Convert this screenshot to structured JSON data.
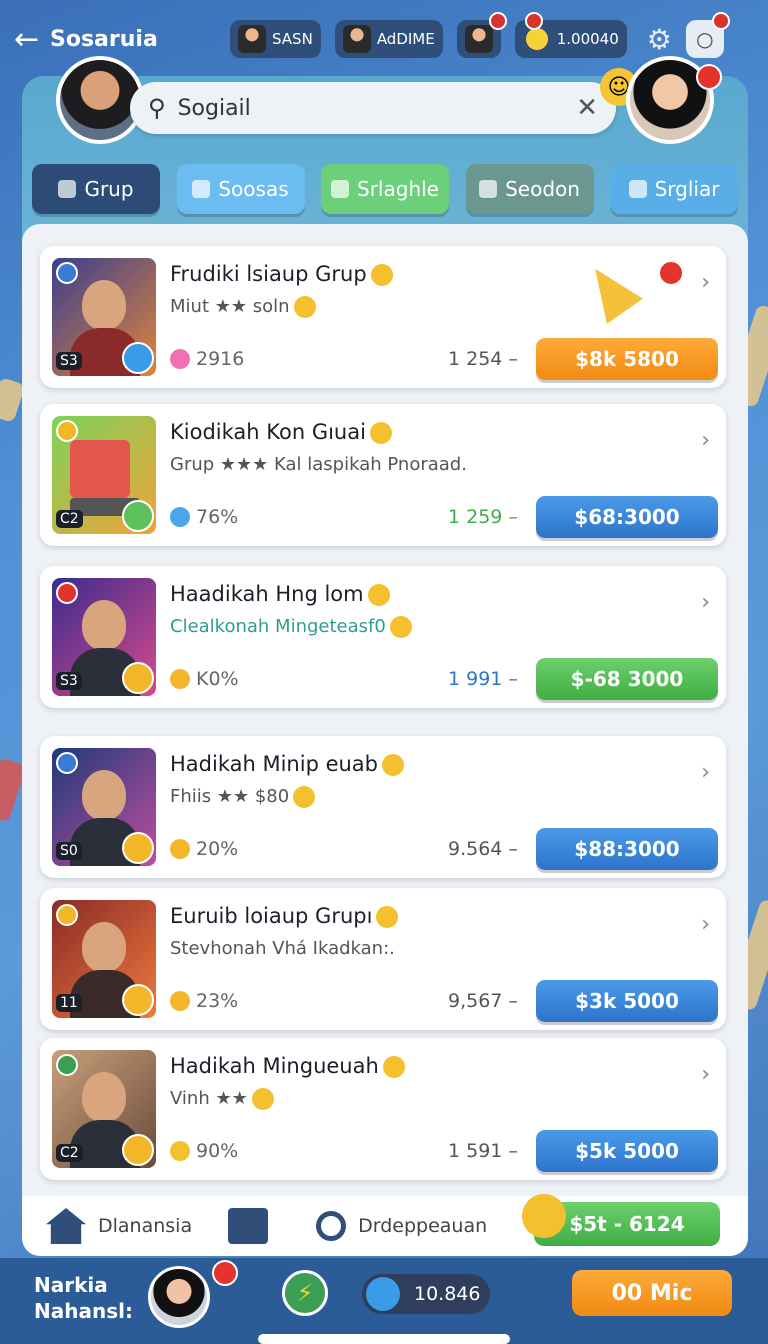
{
  "topbar": {
    "title": "Sosaruia",
    "chips": [
      {
        "label": "SASN"
      },
      {
        "label": "AdDIME"
      },
      {
        "label": ""
      },
      {
        "label": "1.00040"
      }
    ]
  },
  "search": {
    "value": "Sogiail"
  },
  "tabs": [
    {
      "label": "Grup"
    },
    {
      "label": "Soosas"
    },
    {
      "label": "Srlaghle"
    },
    {
      "label": "Seodon"
    },
    {
      "label": "Srgliar"
    }
  ],
  "cards": [
    {
      "title": "Frudiki lsiaup Grup",
      "sub": "Miut ★★ soln",
      "stat": "2916",
      "num": "1 254 –",
      "price": "$8k 5800",
      "level": "S3",
      "btn_color": "orange"
    },
    {
      "title": "Kiodikah Kon Gıuai",
      "sub": "Grup ★★★ Kal laspikah Pnoraad.",
      "stat": "76%",
      "num": "1 259 –",
      "price": "$68:3000",
      "level": "C2",
      "btn_color": "blue"
    },
    {
      "title": "Haadikah Hng lom",
      "sub": "Clealkonah Mingeteasf0",
      "stat": "K0%",
      "num": "1 991 –",
      "price": "$-68 3000",
      "level": "S3",
      "btn_color": "green"
    },
    {
      "title": "Hadikah Minip euab",
      "sub": "Fhiis ★★ $80",
      "stat": "20%",
      "num": "9.564 –",
      "price": "$88:3000",
      "level": "S0",
      "btn_color": "blue"
    },
    {
      "title": "Euruib loiaup Grupı",
      "sub": "Stevhonah Vhá Ikadkan:.",
      "stat": "23%",
      "num": "9,567 –",
      "price": "$3k 5000",
      "level": "11",
      "btn_color": "blue"
    },
    {
      "title": "Hadikah Minguеuah",
      "sub": "Vinh ★★",
      "stat": "90%",
      "num": "1 591 –",
      "price": "$5k 5000",
      "level": "C2",
      "btn_color": "blue"
    }
  ],
  "bottom_nav": {
    "items": [
      {
        "label": "Dlanansia",
        "icon": "home-icon"
      },
      {
        "label": "",
        "icon": "wallet-icon"
      },
      {
        "label": "Drdeppeauan",
        "icon": "search-icon"
      }
    ],
    "cta": "$5t - 6124"
  },
  "footer": {
    "name_line1": "Narkia",
    "name_line2": "Nahansl:",
    "followers": "10.846",
    "mic_label": "00 Mic"
  },
  "colors": {
    "accent_orange": "#f08a12",
    "accent_blue": "#2d74cc",
    "accent_green": "#3fae45",
    "panel_top": "#5aa8d0"
  }
}
